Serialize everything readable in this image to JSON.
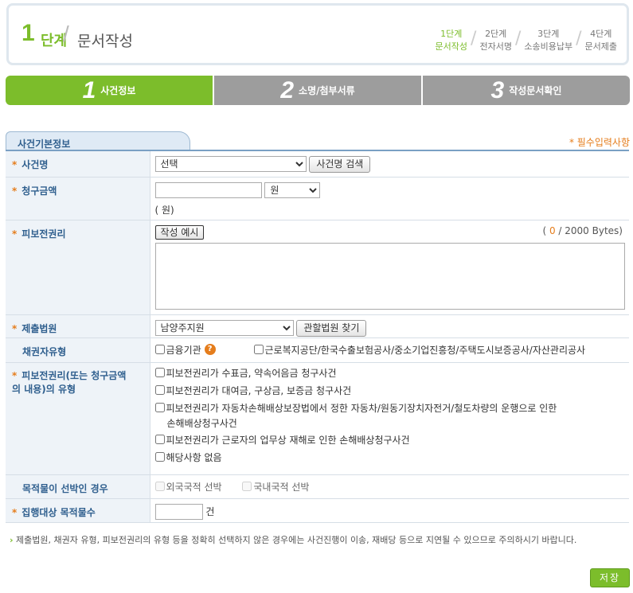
{
  "header": {
    "step_number": "1",
    "step_word": "단계",
    "title": "문서작성",
    "steps": [
      {
        "top": "1단계",
        "bottom": "문서작성",
        "active": true
      },
      {
        "top": "2단계",
        "bottom": "전자서명",
        "active": false
      },
      {
        "top": "3단계",
        "bottom": "소송비용납부",
        "active": false
      },
      {
        "top": "4단계",
        "bottom": "문서제출",
        "active": false
      }
    ]
  },
  "tabs": [
    {
      "num": "1",
      "label": "사건정보",
      "active": true
    },
    {
      "num": "2",
      "label": "소명/첨부서류",
      "active": false
    },
    {
      "num": "3",
      "label": "작성문서확인",
      "active": false
    }
  ],
  "section": {
    "title": "사건기본정보",
    "required_note": "* 필수입력사항"
  },
  "fields": {
    "case_name": {
      "label": "사건명",
      "selected": "선택",
      "search_button": "사건명 검색"
    },
    "claim_amount": {
      "label": "청구금액",
      "value": "",
      "unit_selected": "원",
      "hint": "( 원)"
    },
    "preserved_right": {
      "label": "피보전권리",
      "example_button": "작성 예시",
      "bytes_current": "0",
      "bytes_suffix": "/ 2000 Bytes)",
      "bytes_prefix": "(",
      "value": ""
    },
    "court": {
      "label": "제출법원",
      "selected": "남양주지원",
      "find_button": "관할법원 찾기"
    },
    "creditor_type": {
      "label": "채권자유형",
      "options": [
        "금융기관",
        "근로복지공단/한국수출보험공사/중소기업진흥청/주택도시보증공사/자산관리공사"
      ]
    },
    "right_type": {
      "label_line1": "피보전권리(또는 청구금액",
      "label_line2": "의 내용)의 유형",
      "options": [
        "피보전권리가 수표금, 약속어음금 청구사건",
        "피보전권리가 대여금, 구상금, 보증금 청구사건",
        "피보전권리가 자동차손해배상보장법에서 정한 자동차/원동기장치자전거/철도차량의 운행으로 인한",
        "손해배상청구사건",
        "피보전권리가 근로자의 업무상 재해로 인한 손해배상청구사건",
        "해당사항 없음"
      ]
    },
    "ship_case": {
      "label": "목적물이 선박인 경우",
      "options": [
        "외국국적 선박",
        "국내국적 선박"
      ]
    },
    "target_count": {
      "label": "집행대상 목적물수",
      "value": "",
      "unit": "건"
    }
  },
  "notice": "제출법원, 채권자 유형, 피보전권리의 유형 등을 정확히 선택하지 않은 경우에는 사건진행이 이송, 재배당 등으로 지연될 수 있으므로 주의하시기 바랍니다.",
  "save_label": "저장",
  "colors": {
    "accent": "#7cbd2b",
    "label_text": "#2f5f8e",
    "required": "#e57d1c",
    "tab_inactive": "#9d9d9d"
  }
}
